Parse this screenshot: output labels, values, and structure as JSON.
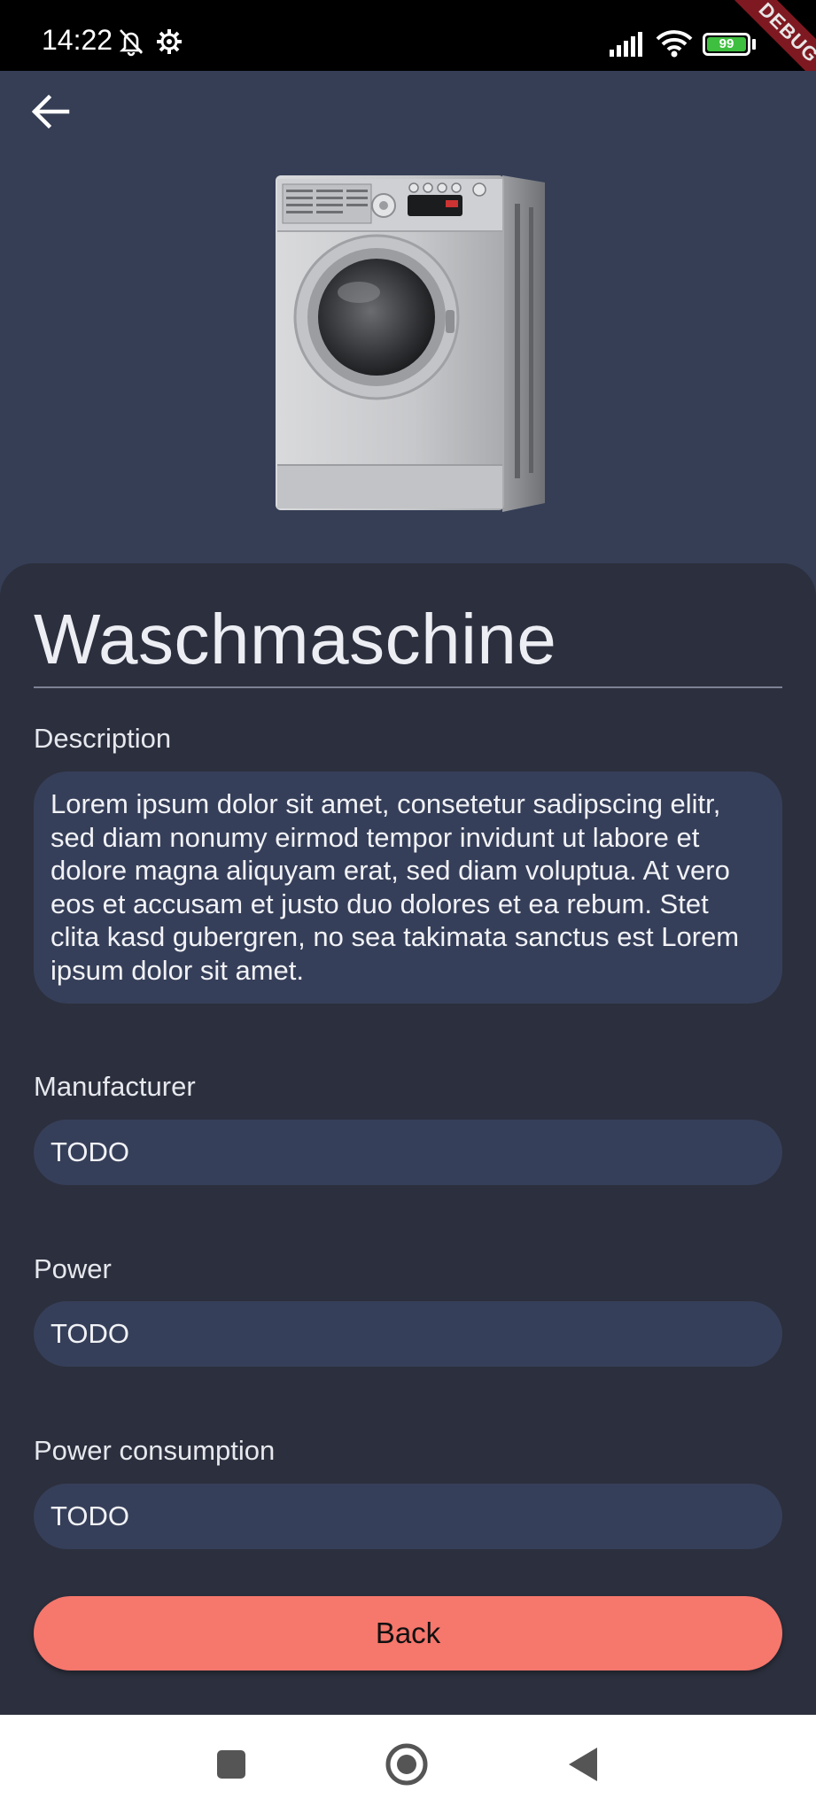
{
  "status_bar": {
    "time": "14:22",
    "battery": "99",
    "debug_banner": "DEBUG",
    "battery_color": "#3fbf3f"
  },
  "appliance": {
    "title": "Waschmaschine",
    "description_label": "Description",
    "description": "Lorem ipsum dolor sit amet, consetetur sadipscing elitr, sed diam nonumy eirmod tempor invidunt ut labore et dolore magna aliquyam erat, sed diam voluptua. At vero eos et accusam et justo duo dolores et ea rebum. Stet clita kasd gubergren, no sea takimata sanctus est Lorem ipsum dolor sit amet.",
    "fields": [
      {
        "label": "Manufacturer",
        "value": "TODO"
      },
      {
        "label": "Power",
        "value": "TODO"
      },
      {
        "label": "Power consumption",
        "value": "TODO"
      }
    ]
  },
  "actions": {
    "back_label": "Back"
  },
  "icons": {
    "back": "arrow-left-icon",
    "hero": "washing-machine-image",
    "nav_recents": "square-icon",
    "nav_home": "circle-icon",
    "nav_back": "triangle-back-icon"
  },
  "colors": {
    "hero_background": "#353e55",
    "page_background": "#2c2f3d",
    "field_background": "#363f59",
    "button_accent": "#f6776c"
  }
}
